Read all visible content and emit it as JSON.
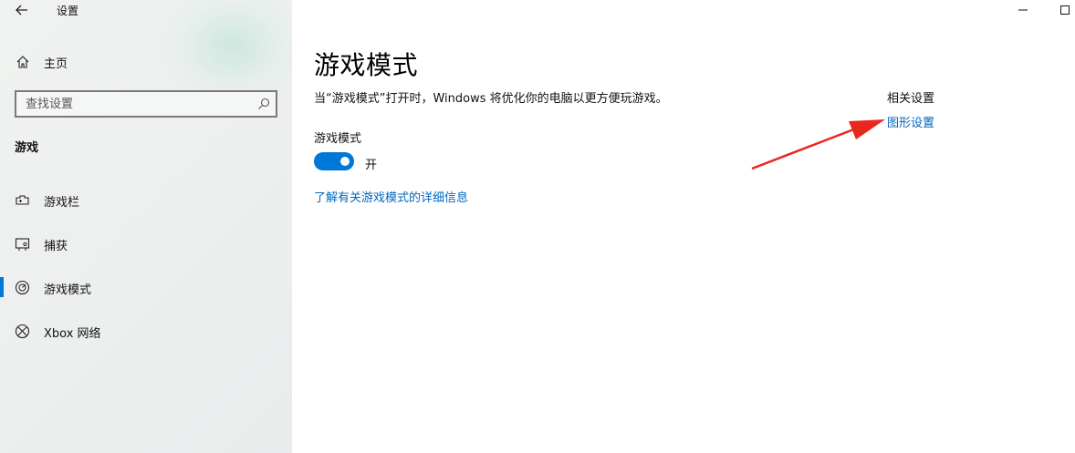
{
  "window": {
    "title": "设置",
    "controls": {
      "minimize": "minimize-icon",
      "maximize": "maximize-icon"
    }
  },
  "sidebar": {
    "home_label": "主页",
    "search_placeholder": "查找设置",
    "section": "游戏",
    "items": [
      {
        "label": "游戏栏",
        "icon": "game-bar-icon",
        "selected": false
      },
      {
        "label": "捕获",
        "icon": "capture-icon",
        "selected": false
      },
      {
        "label": "游戏模式",
        "icon": "game-mode-icon",
        "selected": true
      },
      {
        "label": "Xbox 网络",
        "icon": "xbox-icon",
        "selected": false
      }
    ]
  },
  "main": {
    "title": "游戏模式",
    "description": "当“游戏模式”打开时，Windows 将优化你的电脑以更方便玩游戏。",
    "toggle_caption": "游戏模式",
    "toggle_on": true,
    "toggle_state": "开",
    "learn_more_link": "了解有关游戏模式的详细信息"
  },
  "related": {
    "title": "相关设置",
    "link": "图形设置"
  },
  "annotation": {
    "type": "arrow",
    "color": "#e8281e"
  },
  "colors": {
    "accent": "#0078d7",
    "link": "#0067c0",
    "sidebar_bg": "#eef0ef"
  }
}
